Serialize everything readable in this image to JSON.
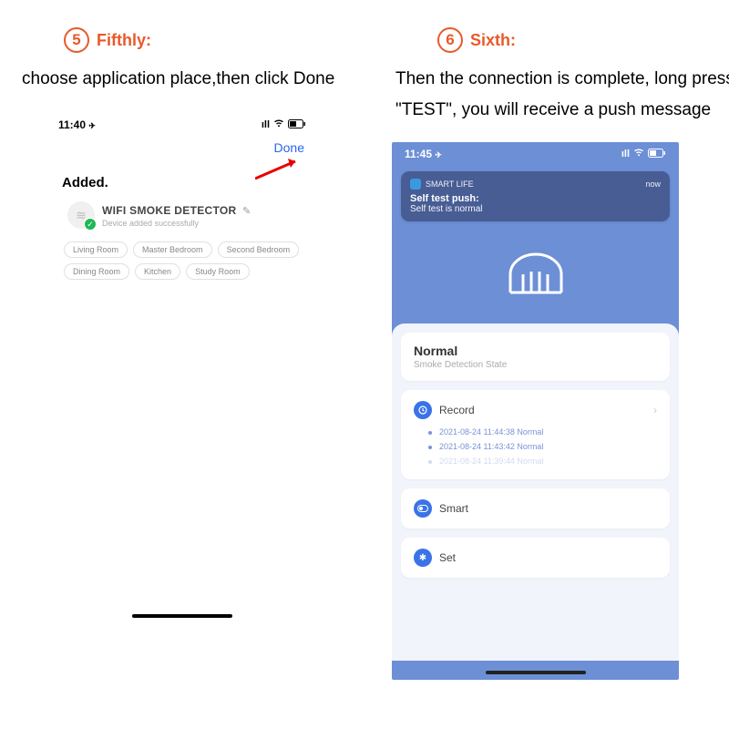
{
  "left": {
    "step_num": "5",
    "step_label": "Fifthly:",
    "desc": "choose application place,then click Done",
    "time": "11:40",
    "signal": "◂",
    "done": "Done",
    "added": "Added.",
    "device_name": "WIFI  SMOKE DETECTOR",
    "device_sub": "Device added successfully",
    "rooms": [
      "Living Room",
      "Master Bedroom",
      "Second Bedroom",
      "Dining Room",
      "Kitchen",
      "Study Room"
    ]
  },
  "right": {
    "step_num": "6",
    "step_label": "Sixth:",
    "desc": "Then the connection is complete, long press \"TEST\", you will receive a push message",
    "time": "11:45",
    "notif_app": "SMART LIFE",
    "notif_now": "now",
    "notif_title": "Self test push:",
    "notif_body": "Self test is normal",
    "state_title": "Normal",
    "state_sub": "Smoke Detection State",
    "record_label": "Record",
    "records": [
      "2021-08-24 11:44:38 Normal",
      "2021-08-24 11:43:42 Normal",
      "2021-08-24 11:39:44 Normal"
    ],
    "smart_label": "Smart",
    "set_label": "Set"
  }
}
